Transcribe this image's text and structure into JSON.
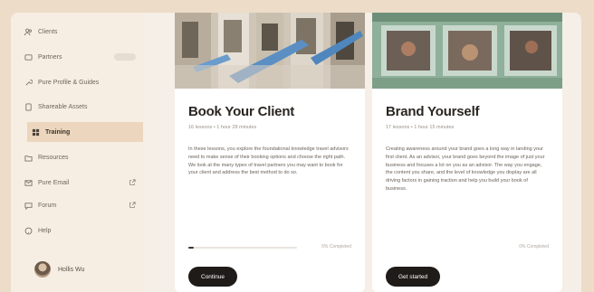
{
  "sidebar": {
    "items": [
      {
        "label": "Clients",
        "icon": "people-icon"
      },
      {
        "label": "Partners",
        "icon": "partners-icon",
        "badge": true
      },
      {
        "label": "Pure Profile & Guides",
        "icon": "wrench-icon"
      },
      {
        "label": "Shareable Assets",
        "icon": "document-icon"
      },
      {
        "label": "Training",
        "icon": "grid-icon",
        "active": true
      },
      {
        "label": "Resources",
        "icon": "folder-icon"
      },
      {
        "label": "Pure Email",
        "icon": "mail-icon",
        "external": true
      },
      {
        "label": "Forum",
        "icon": "chat-icon",
        "external": true
      },
      {
        "label": "Help",
        "icon": "help-icon"
      }
    ],
    "profile": {
      "name": "Hollis Wu"
    }
  },
  "cards": [
    {
      "title": "Book Your Client",
      "meta": "16 lessons • 1 hour 28 minutes",
      "description": "In these lessons, you explore the foundational knowledge travel advisors need to make sense of their booking options and choose the right path. We look at the many types of travel partners you may want to book for your client and address the best method to do so.",
      "progress": 0.05,
      "progress_label": "5% Completed",
      "button": "Continue"
    },
    {
      "title": "Brand Yourself",
      "meta": "17 lessons • 1 hour 15 minutes",
      "description": "Creating awareness around your brand goes a long way in landing your first client. As an advisor, your brand goes beyond the image of just your business and focuses a lot on you as an advisor. The way you engage, the content you share, and the level of knowledge you display are all driving factors in gaining traction and help you build your book of business.",
      "progress": 0,
      "progress_label": "0% Completed",
      "button": "Get started"
    }
  ],
  "colors": {
    "background": "#ecdcc8",
    "sidebar": "#f6eee3",
    "active_item": "#ecd6bd",
    "button": "#1f1b18"
  }
}
